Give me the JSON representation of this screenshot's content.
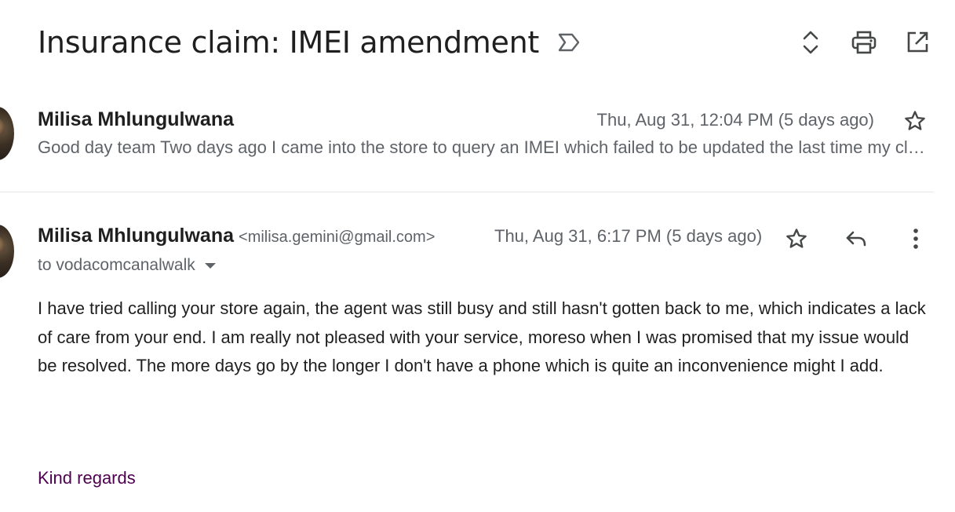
{
  "thread": {
    "subject": "Insurance claim: IMEI amendment",
    "icons": {
      "label": "label-important-icon",
      "expand": "expand-all-icon",
      "print": "print-icon",
      "open_new": "open-in-new-window-icon"
    }
  },
  "messages": [
    {
      "state": "collapsed",
      "sender": "Milisa Mhlungulwana",
      "date": "Thu, Aug 31, 12:04 PM (5 days ago)",
      "snippet": "Good day team Two days ago I came into the store to query an IMEI which failed to be updated the last time my claim was processed",
      "star_icon": "star-outline-icon"
    },
    {
      "state": "expanded",
      "sender": "Milisa Mhlungulwana",
      "email": "<milisa.gemini@gmail.com>",
      "date": "Thu, Aug 31, 6:17 PM (5 days ago)",
      "to": "to vodacomcanalwalk",
      "body": "I have tried calling your store again, the agent was still busy and still hasn't gotten back to me, which indicates a lack of care from your end. I am really not pleased with your service, moreso when I was promised that my issue would be resolved. The more days go by the longer I don't have a phone which is quite an inconvenience might I add.",
      "signoff": "Kind regards",
      "icons": {
        "star": "star-outline-icon",
        "reply": "reply-icon",
        "more": "more-vert-icon"
      }
    }
  ],
  "colors": {
    "text": "#1f1f1f",
    "secondary": "#5f6368",
    "signoff": "#500050",
    "divider": "#e6e6e6"
  }
}
